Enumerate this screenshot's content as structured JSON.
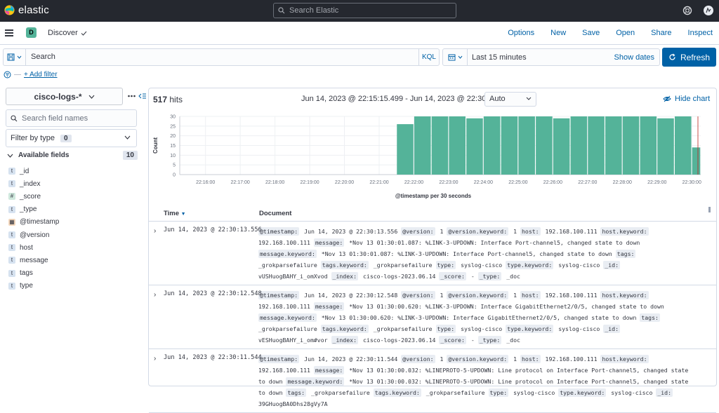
{
  "app": {
    "name": "elastic",
    "search_placeholder": "Search Elastic"
  },
  "nav": {
    "badge": "D",
    "title": "Discover",
    "links": [
      "Options",
      "New",
      "Save",
      "Open",
      "Share",
      "Inspect"
    ]
  },
  "query": {
    "placeholder": "Search",
    "language": "KQL",
    "time_range": "Last 15 minutes",
    "show_dates": "Show dates",
    "refresh": "Refresh"
  },
  "filter": {
    "add": "+ Add filter"
  },
  "sidebar": {
    "index_pattern": "cisco-logs-*",
    "field_search_placeholder": "Search field names",
    "filter_by_type": "Filter by type",
    "filter_count": "0",
    "available_label": "Available fields",
    "available_count": "10",
    "fields": [
      {
        "name": "_id",
        "type": "t"
      },
      {
        "name": "_index",
        "type": "t"
      },
      {
        "name": "_score",
        "type": "#"
      },
      {
        "name": "_type",
        "type": "t"
      },
      {
        "name": "@timestamp",
        "type": "date"
      },
      {
        "name": "@version",
        "type": "t"
      },
      {
        "name": "host",
        "type": "t"
      },
      {
        "name": "message",
        "type": "t"
      },
      {
        "name": "tags",
        "type": "t"
      },
      {
        "name": "type",
        "type": "t"
      }
    ]
  },
  "results": {
    "hits_count": "517",
    "hits_label": "hits",
    "range": "Jun 14, 2023 @ 22:15:15.499 - Jun 14, 2023 @ 22:30:15.499",
    "interval": "Auto",
    "hide_chart": "Hide chart"
  },
  "chart_data": {
    "type": "bar",
    "xlabel": "@timestamp per 30 seconds",
    "ylabel": "Count",
    "ylim": [
      0,
      30
    ],
    "yticks": [
      0,
      5,
      10,
      15,
      20,
      25,
      30
    ],
    "xticks": [
      "22:16:00",
      "22:17:00",
      "22:18:00",
      "22:19:00",
      "22:20:00",
      "22:21:00",
      "22:22:00",
      "22:23:00",
      "22:24:00",
      "22:25:00",
      "22:26:00",
      "22:27:00",
      "22:28:00",
      "22:29:00",
      "22:30:00"
    ],
    "bars": [
      {
        "x": "22:21:30",
        "y": 26
      },
      {
        "x": "22:22:00",
        "y": 30
      },
      {
        "x": "22:22:30",
        "y": 30
      },
      {
        "x": "22:23:00",
        "y": 30
      },
      {
        "x": "22:23:30",
        "y": 29
      },
      {
        "x": "22:24:00",
        "y": 30
      },
      {
        "x": "22:24:30",
        "y": 30
      },
      {
        "x": "22:25:00",
        "y": 30
      },
      {
        "x": "22:25:30",
        "y": 30
      },
      {
        "x": "22:26:00",
        "y": 29
      },
      {
        "x": "22:26:30",
        "y": 30
      },
      {
        "x": "22:27:00",
        "y": 30
      },
      {
        "x": "22:27:30",
        "y": 30
      },
      {
        "x": "22:28:00",
        "y": 30
      },
      {
        "x": "22:28:30",
        "y": 30
      },
      {
        "x": "22:29:00",
        "y": 29
      },
      {
        "x": "22:29:30",
        "y": 30
      },
      {
        "x": "22:30:00",
        "y": 14
      }
    ],
    "color": "#54b399"
  },
  "table": {
    "col_time": "Time",
    "col_doc": "Document",
    "rows": [
      {
        "time": "Jun 14, 2023 @ 22:30:13.556",
        "fields": [
          [
            "@timestamp:",
            "Jun 14, 2023 @ 22:30:13.556"
          ],
          [
            "@version:",
            "1"
          ],
          [
            "@version.keyword:",
            "1"
          ],
          [
            "host:",
            "192.168.100.111"
          ],
          [
            "host.keyword:",
            "192.168.100.111"
          ],
          [
            "message:",
            "*Nov 13 01:30:01.087: %LINK-3-UPDOWN: Interface Port-channel5, changed state to down"
          ],
          [
            "message.keyword:",
            "*Nov 13 01:30:01.087: %LINK-3-UPDOWN: Interface Port-channel5, changed state to down"
          ],
          [
            "tags:",
            "_grokparsefailure"
          ],
          [
            "tags.keyword:",
            "_grokparsefailure"
          ],
          [
            "type:",
            "syslog-cisco"
          ],
          [
            "type.keyword:",
            "syslog-cisco"
          ],
          [
            "_id:",
            "vUSHuogBAHY_i_omXvod"
          ],
          [
            "_index:",
            "cisco-logs-2023.06.14"
          ],
          [
            "_score:",
            "-"
          ],
          [
            "_type:",
            "_doc"
          ]
        ]
      },
      {
        "time": "Jun 14, 2023 @ 22:30:12.548",
        "fields": [
          [
            "@timestamp:",
            "Jun 14, 2023 @ 22:30:12.548"
          ],
          [
            "@version:",
            "1"
          ],
          [
            "@version.keyword:",
            "1"
          ],
          [
            "host:",
            "192.168.100.111"
          ],
          [
            "host.keyword:",
            "192.168.100.111"
          ],
          [
            "message:",
            "*Nov 13 01:30:00.620: %LINK-3-UPDOWN: Interface GigabitEthernet2/0/5, changed state to down"
          ],
          [
            "message.keyword:",
            "*Nov 13 01:30:00.620: %LINK-3-UPDOWN: Interface GigabitEthernet2/0/5, changed state to down"
          ],
          [
            "tags:",
            "_grokparsefailure"
          ],
          [
            "tags.keyword:",
            "_grokparsefailure"
          ],
          [
            "type:",
            "syslog-cisco"
          ],
          [
            "type.keyword:",
            "syslog-cisco"
          ],
          [
            "_id:",
            "vESHuogBAHY_i_om#vor"
          ],
          [
            "_index:",
            "cisco-logs-2023.06.14"
          ],
          [
            "_score:",
            "-"
          ],
          [
            "_type:",
            "_doc"
          ]
        ]
      },
      {
        "time": "Jun 14, 2023 @ 22:30:11.544",
        "fields": [
          [
            "@timestamp:",
            "Jun 14, 2023 @ 22:30:11.544"
          ],
          [
            "@version:",
            "1"
          ],
          [
            "@version.keyword:",
            "1"
          ],
          [
            "host:",
            "192.168.100.111"
          ],
          [
            "host.keyword:",
            "192.168.100.111"
          ],
          [
            "message:",
            "*Nov 13 01:30:00.032: %LINEPROTO-5-UPDOWN: Line protocol on Interface Port-channel5, changed state to down"
          ],
          [
            "message.keyword:",
            "*Nov 13 01:30:00.032: %LINEPROTO-5-UPDOWN: Line protocol on Interface Port-channel5, changed state to down"
          ],
          [
            "tags:",
            "_grokparsefailure"
          ],
          [
            "tags.keyword:",
            "_grokparsefailure"
          ],
          [
            "type:",
            "syslog-cisco"
          ],
          [
            "type.keyword:",
            "syslog-cisco"
          ],
          [
            "_id:",
            "39GHuogBA0Dhs28gVy7A"
          ]
        ]
      }
    ]
  }
}
